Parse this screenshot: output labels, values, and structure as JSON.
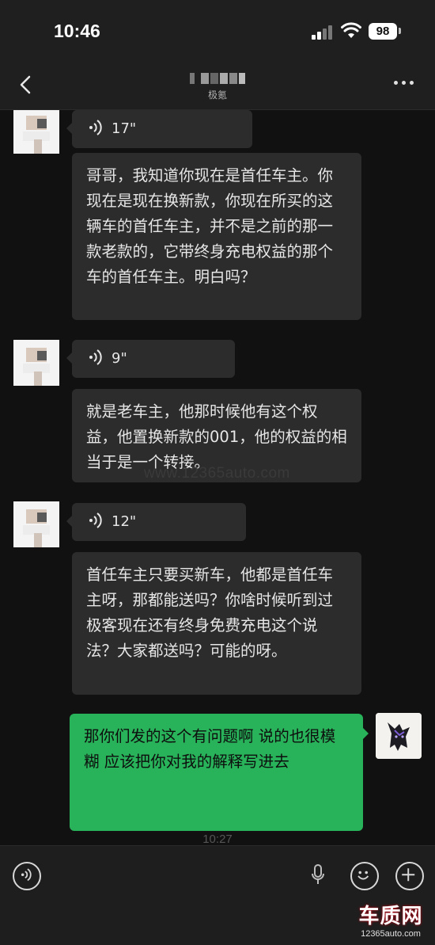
{
  "status_bar": {
    "time": "10:46",
    "battery": "98"
  },
  "nav": {
    "subtitle": "极氪"
  },
  "messages": [
    {
      "type": "voice",
      "duration": "17\""
    },
    {
      "type": "text",
      "text": "哥哥，我知道你现在是首任车主。你现在是现在换新款，你现在所买的这辆车的首任车主，并不是之前的那一款老款的，它带终身充电权益的那个车的首任车主。明白吗？"
    },
    {
      "type": "voice",
      "duration": "9\""
    },
    {
      "type": "text",
      "text": "就是老车主，他那时候他有这个权益，他置换新款的001，他的权益的相当于是一个转接。"
    },
    {
      "type": "voice",
      "duration": "12\""
    },
    {
      "type": "text",
      "text": "首任车主只要买新车，他都是首任车主呀，那都能送吗？你啥时候听到过极客现在还有终身免费充电这个说法？大家都送吗？可能的呀。"
    },
    {
      "type": "text_outgoing",
      "text": "那你们发的这个有问题啊 说的也很模糊 应该把你对我的解释写进去"
    }
  ],
  "timestamp": "10:27",
  "watermark": "www.12365auto.com",
  "logo": {
    "main": "车质网",
    "sub": "12365auto.com"
  },
  "colors": {
    "outgoing_bubble": "#28b35a",
    "incoming_bubble": "#2c2c2c",
    "background": "#111111"
  }
}
